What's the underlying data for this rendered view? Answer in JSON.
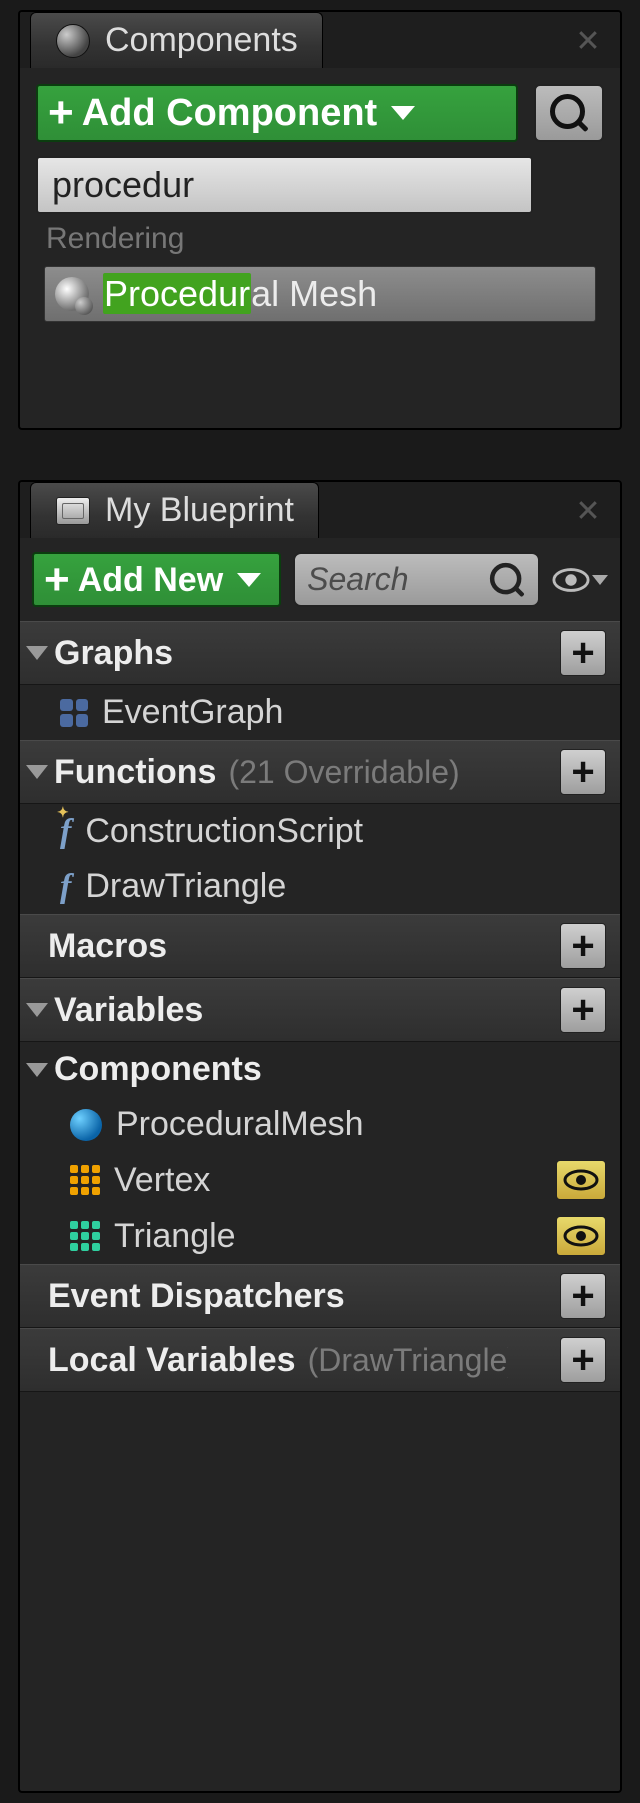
{
  "components": {
    "tab_title": "Components",
    "add_button": "Add Component",
    "search_value": "procedur",
    "category": "Rendering",
    "result_highlight": "Procedur",
    "result_suffix": "al Mesh"
  },
  "blueprint": {
    "tab_title": "My Blueprint",
    "add_button": "Add New",
    "search_placeholder": "Search",
    "sections": {
      "graphs": {
        "title": "Graphs",
        "items": [
          {
            "label": "EventGraph"
          }
        ]
      },
      "functions": {
        "title": "Functions",
        "sub": "(21 Overridable)",
        "items": [
          {
            "label": "ConstructionScript"
          },
          {
            "label": "DrawTriangle"
          }
        ]
      },
      "macros": {
        "title": "Macros"
      },
      "variables": {
        "title": "Variables"
      },
      "components_sec": {
        "title": "Components",
        "items": [
          {
            "label": "ProceduralMesh"
          },
          {
            "label": "Vertex"
          },
          {
            "label": "Triangle"
          }
        ]
      },
      "dispatchers": {
        "title": "Event Dispatchers"
      },
      "localvars": {
        "title": "Local Variables",
        "sub": "(DrawTriangle)"
      }
    }
  }
}
